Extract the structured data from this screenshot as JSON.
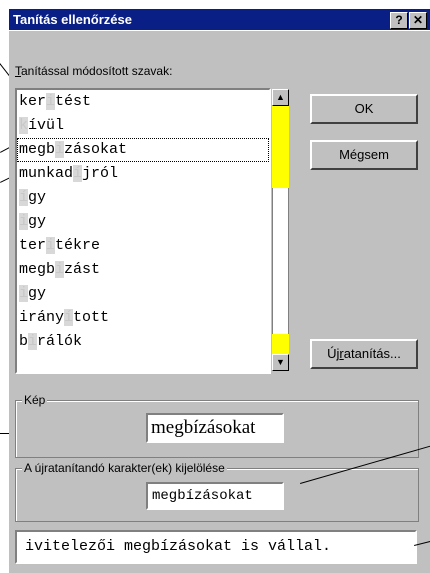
{
  "window": {
    "title": "Tanítás ellenőrzése",
    "help_label": "?",
    "close_label": "✕"
  },
  "words_list": {
    "label_prefix": "T",
    "label_rest": "anítással módosított szavak:",
    "items": [
      {
        "pre": "ker",
        "mark": "i",
        "post": "tést"
      },
      {
        "pre": "",
        "mark": "k",
        "post": "ívül"
      },
      {
        "pre": "megb",
        "mark": "i",
        "post": "zásokat"
      },
      {
        "pre": "munkad",
        "mark": "í",
        "post": "jról"
      },
      {
        "pre": "",
        "mark": "í",
        "post": "gy"
      },
      {
        "pre": "",
        "mark": "i",
        "post": "gy"
      },
      {
        "pre": "ter",
        "mark": "i",
        "post": "tékre"
      },
      {
        "pre": "megb",
        "mark": "i",
        "post": "zást"
      },
      {
        "pre": "",
        "mark": "i",
        "post": "gy"
      },
      {
        "pre": "irány",
        "mark": "í",
        "post": "tott"
      },
      {
        "pre": "b",
        "mark": "i",
        "post": "rálók"
      }
    ],
    "selected_index": 2
  },
  "buttons": {
    "ok": "OK",
    "cancel": "Mégsem",
    "retrain_prefix": "Új",
    "retrain_underline": "r",
    "retrain_rest": "atanítás..."
  },
  "image_group": {
    "title": "Kép",
    "word": "megbízásokat"
  },
  "retrain_chars_group": {
    "title": "A újratanítandó karakter(ek) kijelölése",
    "word": "megbízásokat"
  },
  "context_line": "ivitelezői megbízásokat is vállal.",
  "colors": {
    "titlebar": "#0a1f86",
    "dialog_face": "#c0c0c0",
    "scroll_highlight": "#ffff00"
  }
}
